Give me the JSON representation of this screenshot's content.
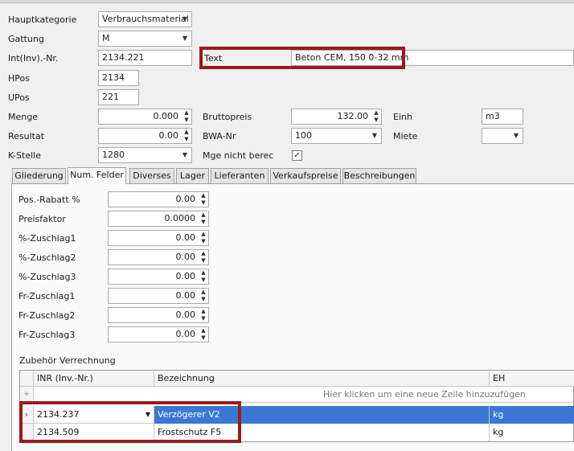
{
  "header": {
    "hauptkategorie": {
      "label": "Hauptkategorie",
      "value": "Verbrauchsmaterial"
    },
    "gattung": {
      "label": "Gattung",
      "value": "M"
    },
    "int_nr": {
      "label": "Int(Inv).-Nr.",
      "value": "2134.221"
    },
    "text": {
      "label": "Text",
      "value": "Beton CEM, 150  0-32 mm"
    },
    "hpos": {
      "label": "HPos",
      "value": "2134"
    },
    "upos": {
      "label": "UPos",
      "value": "221"
    },
    "menge": {
      "label": "Menge",
      "value": "0.000"
    },
    "bruttopreis": {
      "label": "Bruttopreis",
      "value": "132.00"
    },
    "einh": {
      "label": "Einh",
      "value": "m3"
    },
    "resultat": {
      "label": "Resultat",
      "value": "0.00"
    },
    "bwa_nr": {
      "label": "BWA-Nr",
      "value": "100"
    },
    "miete": {
      "label": "Miete",
      "value": ""
    },
    "k_stelle": {
      "label": "K-Stelle",
      "value": "1280"
    },
    "mge_nicht_berec": {
      "label": "Mge nicht berec",
      "checked": true
    }
  },
  "tabs": [
    {
      "label": "Gliederung",
      "active": false
    },
    {
      "label": "Num. Felder",
      "active": true
    },
    {
      "label": "Diverses",
      "active": false
    },
    {
      "label": "Lager",
      "active": false
    },
    {
      "label": "Lieferanten",
      "active": false
    },
    {
      "label": "Verkaufspreise",
      "active": false
    },
    {
      "label": "Beschreibungen",
      "active": false
    }
  ],
  "num_fields": [
    {
      "label": "Pos.-Rabatt %",
      "value": "0.00"
    },
    {
      "label": "Preisfaktor",
      "value": "0.0000"
    },
    {
      "label": "%-Zuschlag1",
      "value": "0.00"
    },
    {
      "label": "%-Zuschlag2",
      "value": "0.00"
    },
    {
      "label": "%-Zuschlag3",
      "value": "0.00"
    },
    {
      "label": "Fr-Zuschlag1",
      "value": "0.00"
    },
    {
      "label": "Fr-Zuschlag2",
      "value": "0.00"
    },
    {
      "label": "Fr-Zuschlag3",
      "value": "0.00"
    }
  ],
  "zubehoer": {
    "title": "Zubehör Verrechnung",
    "columns": [
      "INR (Inv.-Nr.)",
      "Bezeichnung",
      "EH"
    ],
    "new_row_hint": "Hier klicken um eine neue Zeile hinzuzufügen",
    "rows": [
      {
        "inr": "2134.237",
        "bezeichnung": "Verzögerer V2",
        "eh": "kg",
        "selected": true
      },
      {
        "inr": "2134.509",
        "bezeichnung": "Frostschutz F5",
        "eh": "kg",
        "selected": false
      }
    ]
  },
  "colors": {
    "highlight_box": "#9b1b1b",
    "selection": "#3a78d4"
  }
}
